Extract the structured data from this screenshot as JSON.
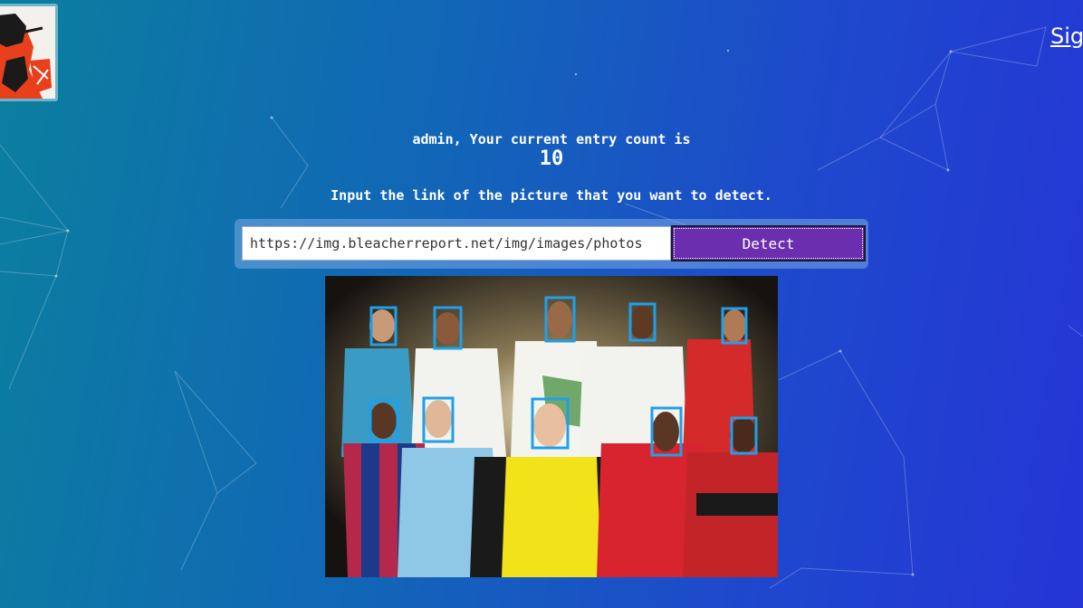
{
  "header": {
    "signin_label": "Sig"
  },
  "main": {
    "greeting": "admin, Your current entry count is",
    "entry_count": "10",
    "instruction": "Input the link of the picture that you want to detect.",
    "url_value": "https://img.bleacherreport.net/img/images/photos",
    "detect_label": "Detect"
  },
  "colors": {
    "button": "#6a2eae",
    "face_box": "#1ea0ea"
  },
  "detected_faces_count": 10
}
